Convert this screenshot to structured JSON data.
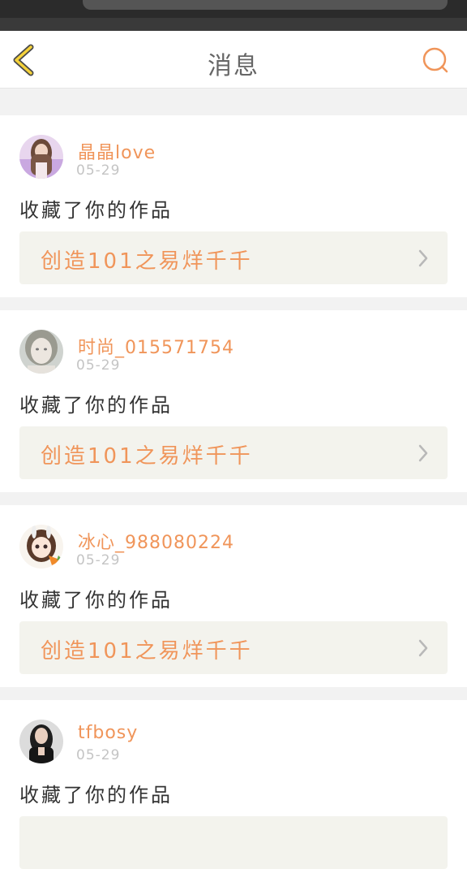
{
  "header": {
    "title": "消息",
    "accent_color": "#f0955a",
    "back_icon": "chevron-left-icon",
    "search_icon": "search-icon"
  },
  "messages": [
    {
      "username": "晶晶love",
      "date": "05-29",
      "action": "收藏了你的作品",
      "work_title": "创造101之易烊千千",
      "avatar": "avatar-girl-long-hair"
    },
    {
      "username": "时尚_015571754",
      "date": "05-29",
      "action": "收藏了你的作品",
      "work_title": "创造101之易烊千千",
      "avatar": "avatar-blurred-face"
    },
    {
      "username": "冰心_988080224",
      "date": "05-29",
      "action": "收藏了你的作品",
      "work_title": "创造101之易烊千千",
      "avatar": "avatar-cartoon-bunny-girl"
    },
    {
      "username": "tfbosy",
      "date": "05-29",
      "action": "收藏了你的作品",
      "work_title": "",
      "avatar": "avatar-woman-dark-hair"
    }
  ]
}
